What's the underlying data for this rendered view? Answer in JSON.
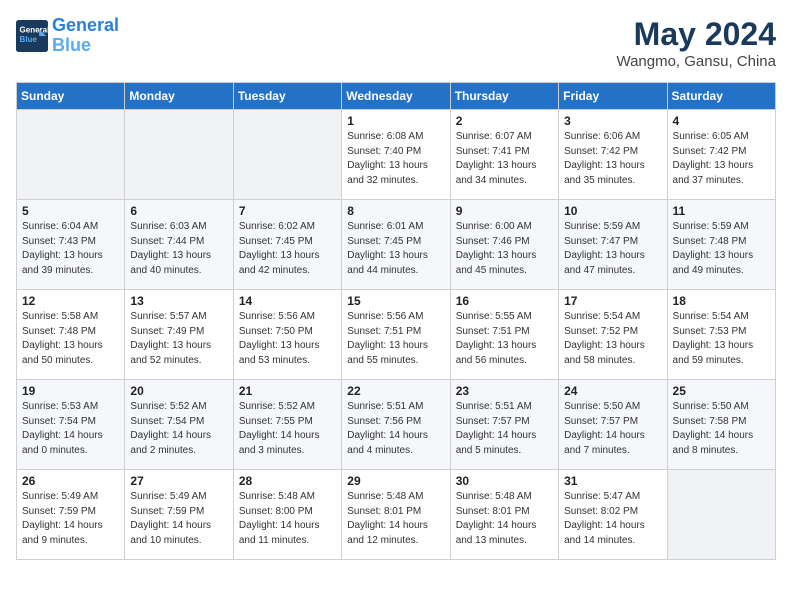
{
  "header": {
    "logo_line1": "General",
    "logo_line2": "Blue",
    "month": "May 2024",
    "location": "Wangmo, Gansu, China"
  },
  "weekdays": [
    "Sunday",
    "Monday",
    "Tuesday",
    "Wednesday",
    "Thursday",
    "Friday",
    "Saturday"
  ],
  "weeks": [
    [
      {
        "day": "",
        "content": ""
      },
      {
        "day": "",
        "content": ""
      },
      {
        "day": "",
        "content": ""
      },
      {
        "day": "1",
        "content": "Sunrise: 6:08 AM\nSunset: 7:40 PM\nDaylight: 13 hours\nand 32 minutes."
      },
      {
        "day": "2",
        "content": "Sunrise: 6:07 AM\nSunset: 7:41 PM\nDaylight: 13 hours\nand 34 minutes."
      },
      {
        "day": "3",
        "content": "Sunrise: 6:06 AM\nSunset: 7:42 PM\nDaylight: 13 hours\nand 35 minutes."
      },
      {
        "day": "4",
        "content": "Sunrise: 6:05 AM\nSunset: 7:42 PM\nDaylight: 13 hours\nand 37 minutes."
      }
    ],
    [
      {
        "day": "5",
        "content": "Sunrise: 6:04 AM\nSunset: 7:43 PM\nDaylight: 13 hours\nand 39 minutes."
      },
      {
        "day": "6",
        "content": "Sunrise: 6:03 AM\nSunset: 7:44 PM\nDaylight: 13 hours\nand 40 minutes."
      },
      {
        "day": "7",
        "content": "Sunrise: 6:02 AM\nSunset: 7:45 PM\nDaylight: 13 hours\nand 42 minutes."
      },
      {
        "day": "8",
        "content": "Sunrise: 6:01 AM\nSunset: 7:45 PM\nDaylight: 13 hours\nand 44 minutes."
      },
      {
        "day": "9",
        "content": "Sunrise: 6:00 AM\nSunset: 7:46 PM\nDaylight: 13 hours\nand 45 minutes."
      },
      {
        "day": "10",
        "content": "Sunrise: 5:59 AM\nSunset: 7:47 PM\nDaylight: 13 hours\nand 47 minutes."
      },
      {
        "day": "11",
        "content": "Sunrise: 5:59 AM\nSunset: 7:48 PM\nDaylight: 13 hours\nand 49 minutes."
      }
    ],
    [
      {
        "day": "12",
        "content": "Sunrise: 5:58 AM\nSunset: 7:48 PM\nDaylight: 13 hours\nand 50 minutes."
      },
      {
        "day": "13",
        "content": "Sunrise: 5:57 AM\nSunset: 7:49 PM\nDaylight: 13 hours\nand 52 minutes."
      },
      {
        "day": "14",
        "content": "Sunrise: 5:56 AM\nSunset: 7:50 PM\nDaylight: 13 hours\nand 53 minutes."
      },
      {
        "day": "15",
        "content": "Sunrise: 5:56 AM\nSunset: 7:51 PM\nDaylight: 13 hours\nand 55 minutes."
      },
      {
        "day": "16",
        "content": "Sunrise: 5:55 AM\nSunset: 7:51 PM\nDaylight: 13 hours\nand 56 minutes."
      },
      {
        "day": "17",
        "content": "Sunrise: 5:54 AM\nSunset: 7:52 PM\nDaylight: 13 hours\nand 58 minutes."
      },
      {
        "day": "18",
        "content": "Sunrise: 5:54 AM\nSunset: 7:53 PM\nDaylight: 13 hours\nand 59 minutes."
      }
    ],
    [
      {
        "day": "19",
        "content": "Sunrise: 5:53 AM\nSunset: 7:54 PM\nDaylight: 14 hours\nand 0 minutes."
      },
      {
        "day": "20",
        "content": "Sunrise: 5:52 AM\nSunset: 7:54 PM\nDaylight: 14 hours\nand 2 minutes."
      },
      {
        "day": "21",
        "content": "Sunrise: 5:52 AM\nSunset: 7:55 PM\nDaylight: 14 hours\nand 3 minutes."
      },
      {
        "day": "22",
        "content": "Sunrise: 5:51 AM\nSunset: 7:56 PM\nDaylight: 14 hours\nand 4 minutes."
      },
      {
        "day": "23",
        "content": "Sunrise: 5:51 AM\nSunset: 7:57 PM\nDaylight: 14 hours\nand 5 minutes."
      },
      {
        "day": "24",
        "content": "Sunrise: 5:50 AM\nSunset: 7:57 PM\nDaylight: 14 hours\nand 7 minutes."
      },
      {
        "day": "25",
        "content": "Sunrise: 5:50 AM\nSunset: 7:58 PM\nDaylight: 14 hours\nand 8 minutes."
      }
    ],
    [
      {
        "day": "26",
        "content": "Sunrise: 5:49 AM\nSunset: 7:59 PM\nDaylight: 14 hours\nand 9 minutes."
      },
      {
        "day": "27",
        "content": "Sunrise: 5:49 AM\nSunset: 7:59 PM\nDaylight: 14 hours\nand 10 minutes."
      },
      {
        "day": "28",
        "content": "Sunrise: 5:48 AM\nSunset: 8:00 PM\nDaylight: 14 hours\nand 11 minutes."
      },
      {
        "day": "29",
        "content": "Sunrise: 5:48 AM\nSunset: 8:01 PM\nDaylight: 14 hours\nand 12 minutes."
      },
      {
        "day": "30",
        "content": "Sunrise: 5:48 AM\nSunset: 8:01 PM\nDaylight: 14 hours\nand 13 minutes."
      },
      {
        "day": "31",
        "content": "Sunrise: 5:47 AM\nSunset: 8:02 PM\nDaylight: 14 hours\nand 14 minutes."
      },
      {
        "day": "",
        "content": ""
      }
    ]
  ]
}
